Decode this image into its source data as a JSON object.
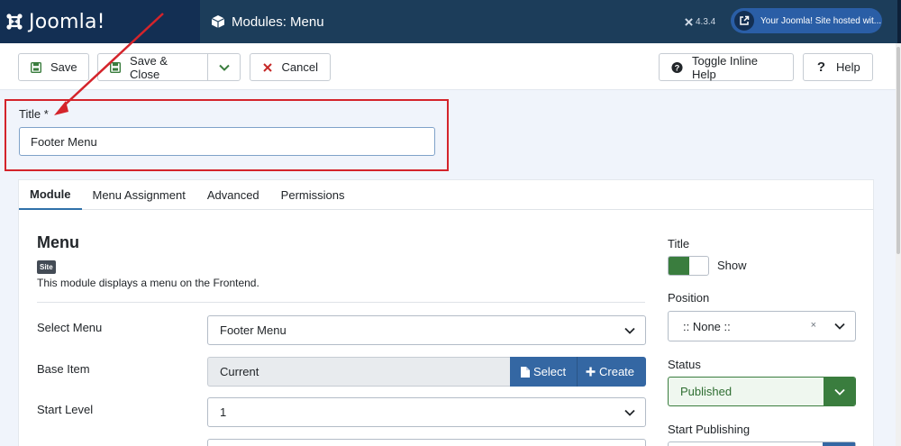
{
  "header": {
    "brand": "Joomla!",
    "page_title": "Modules: Menu",
    "version": "4.3.4",
    "site_link": "Your Joomla! Site hosted wit..."
  },
  "toolbar": {
    "save": "Save",
    "save_close": "Save & Close",
    "cancel": "Cancel",
    "toggle_help": "Toggle Inline Help",
    "help": "Help"
  },
  "title_field": {
    "label": "Title *",
    "value": "Footer Menu"
  },
  "tabs": [
    "Module",
    "Menu Assignment",
    "Advanced",
    "Permissions"
  ],
  "module": {
    "heading": "Menu",
    "badge": "Site",
    "description": "This module displays a menu on the Frontend."
  },
  "fields": {
    "select_menu": {
      "label": "Select Menu",
      "value": "Footer Menu"
    },
    "base_item": {
      "label": "Base Item",
      "value": "Current",
      "select_btn": "Select",
      "create_btn": "Create"
    },
    "start_level": {
      "label": "Start Level",
      "value": "1"
    }
  },
  "sidebar": {
    "title_label": "Title",
    "title_toggle": "Show",
    "title_show": true,
    "position_label": "Position",
    "position_value": ":: None ::",
    "status_label": "Status",
    "status_value": "Published",
    "start_publishing_label": "Start Publishing"
  },
  "colors": {
    "header_bg": "#1c3d5a",
    "brand_bg": "#132f53",
    "accent_blue": "#3467a3",
    "success_green": "#3a7d3e",
    "annotation_red": "#d4242b"
  }
}
